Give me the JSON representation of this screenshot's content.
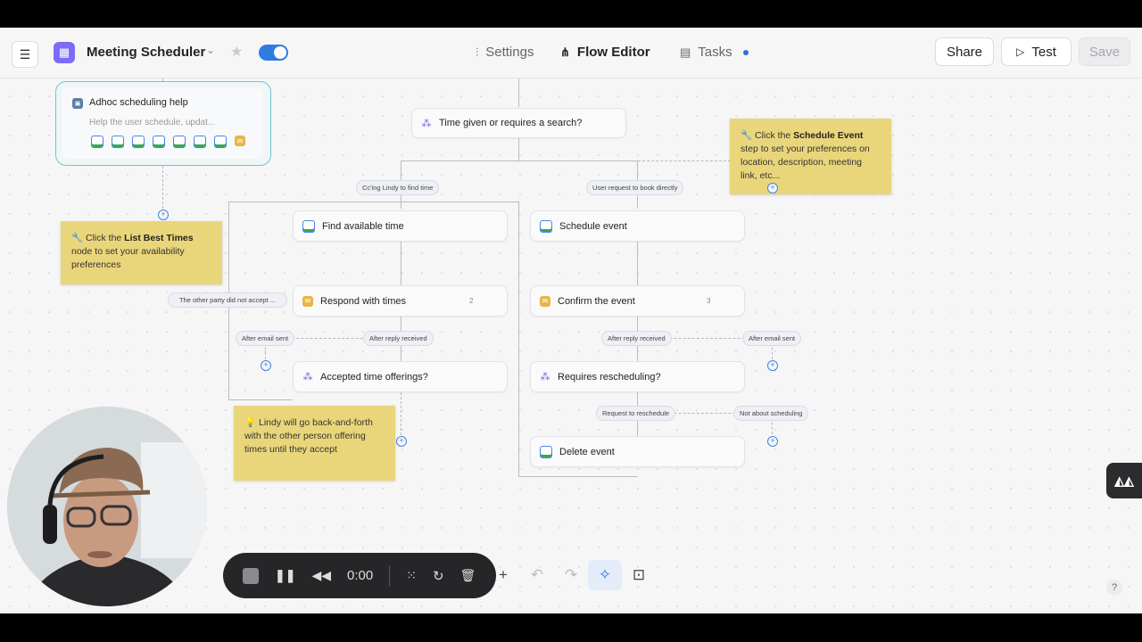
{
  "topbar": {
    "app_icon": "calendar-icon",
    "app_title": "Meeting Scheduler",
    "tabs": [
      {
        "label": "Settings",
        "icon": "sliders-icon",
        "active": false
      },
      {
        "label": "Flow Editor",
        "icon": "flow-icon",
        "active": true
      },
      {
        "label": "Tasks",
        "icon": "tasks-icon",
        "active": false,
        "indicator": true
      }
    ],
    "share_label": "Share",
    "test_label": "Test",
    "save_label": "Save",
    "toggle_on": true
  },
  "flow": {
    "adhoc_node": {
      "title": "Adhoc scheduling help",
      "subtitle": "Help the user schedule, updat..."
    },
    "decision_top": "Time given or requires a search?",
    "branch_left_label": "Cc'ing Lindy to find time",
    "branch_right_label": "User request to book directly",
    "find_time": "Find available time",
    "schedule_event": "Schedule event",
    "respond_times": {
      "label": "Respond with times",
      "count": "2"
    },
    "confirm_event": {
      "label": "Confirm the event",
      "count": "3"
    },
    "other_party_label": "The other party did not accept ...",
    "after_email_sent_left": "After email sent",
    "after_reply_received_left": "After reply received",
    "after_reply_received_right": "After reply received",
    "after_email_sent_right": "After email sent",
    "accepted_offerings": "Accepted time offerings?",
    "requires_rescheduling": "Requires rescheduling?",
    "request_reschedule": "Request to reschedule",
    "not_about_scheduling": "Not about scheduling",
    "delete_event": "Delete event"
  },
  "notes": {
    "schedule_event_note": {
      "prefix": "🔧 Click the ",
      "bold": "Schedule Event",
      "rest": " step to set your preferences on location, description, meeting link, etc..."
    },
    "list_times_note": {
      "prefix": "🔧 Click the ",
      "bold": "List Best Times",
      "rest": " node to set your availability preferences"
    },
    "lindy_note": "💡 Lindy will go back-and-forth with the other person offering times until they accept"
  },
  "player": {
    "time": "0:00"
  },
  "colors": {
    "accent": "#2f7de1",
    "note_yellow": "#ead67a",
    "decision_purple": "#7b5cd6"
  }
}
